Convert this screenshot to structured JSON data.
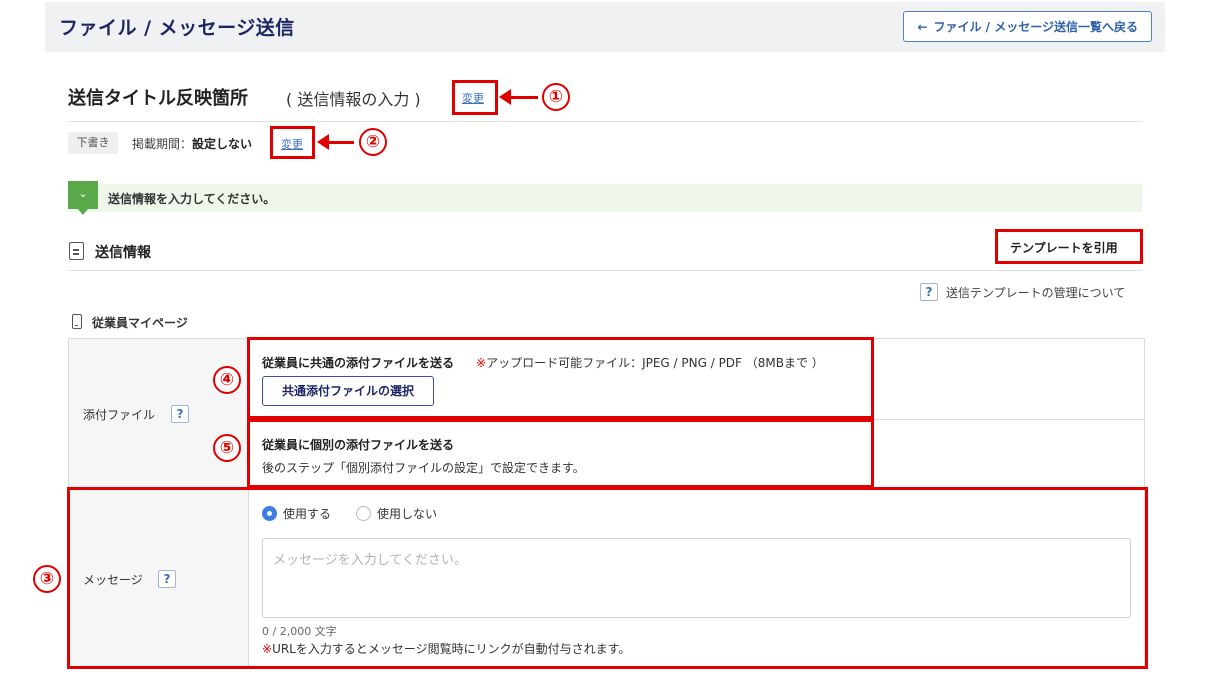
{
  "header": {
    "title": "ファイル / メッセージ送信",
    "back_button": "ファイル / メッセージ送信一覧へ戻る",
    "back_arrow": "←"
  },
  "title_row": {
    "title": "送信タイトル反映箇所",
    "subtitle": "( 送信情報の入力 )",
    "change_link": "変更"
  },
  "status_row": {
    "badge": "下書き",
    "period_label": "掲載期間：",
    "period_value": "設定しない",
    "change_link": "変更"
  },
  "notice": {
    "icon": "chevron-down-icon",
    "text": "送信情報を入力してください。"
  },
  "section": {
    "title": "送信情報",
    "template_button": "テンプレートを引用",
    "help_link": "送信テンプレートの管理について",
    "help_icon": "?",
    "subsection": "従業員マイページ"
  },
  "attachment": {
    "label": "添付ファイル",
    "help_icon": "?",
    "common_title": "従業員に共通の添付ファイルを送る",
    "common_mark": "※",
    "common_note": "アップロード可能ファイル：JPEG / PNG / PDF （8MBまで ）",
    "select_button": "共通添付ファイルの選択",
    "individual_title": "従業員に個別の添付ファイルを送る",
    "individual_note": "後のステップ「個別添付ファイルの設定」で設定できます。"
  },
  "message": {
    "label": "メッセージ",
    "help_icon": "?",
    "option_use": "使用する",
    "option_not_use": "使用しない",
    "selected": "使用する",
    "placeholder": "メッセージを入力してください。",
    "counter": "0 / 2,000 文字",
    "url_mark": "※",
    "url_note": "URLを入力するとメッセージ閲覧時にリンクが自動付与されます。"
  },
  "callouts": [
    "①",
    "②",
    "③",
    "④",
    "⑤"
  ],
  "colors": {
    "accent": "#1d2563",
    "link": "#3a6fc4",
    "callout": "#e10000",
    "notice_bg": "#eef7ea",
    "notice_icon": "#59a84a"
  }
}
